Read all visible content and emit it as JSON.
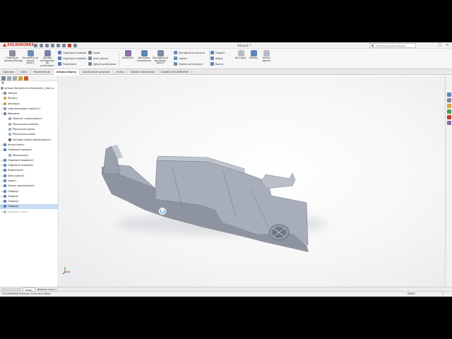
{
  "app": {
    "brand": "SOLIDWORKS",
    "document_title": "Arkusz1 *",
    "search_placeholder": "Polecenia wyszukiwania",
    "window_controls": [
      "–",
      "□",
      "×"
    ]
  },
  "ribbon": {
    "large_buttons": [
      {
        "label": "Odginięcie bazowe/Występ",
        "icon": "base-flange-icon",
        "color": "#8a8f98"
      },
      {
        "label": "Konwertuj na arkusz blachy",
        "icon": "convert-sheet-metal-icon",
        "color": "#6f8fb5"
      },
      {
        "label": "Występ wyciągnięty po przekrojach",
        "icon": "lofted-bend-icon",
        "color": "#7b7fa8"
      }
    ],
    "small_buttons_col1": [
      {
        "label": "Odginięcie krawędzi",
        "icon": "edge-flange-icon",
        "color": "#5b7fb5"
      },
      {
        "label": "Odginięcie dookolne",
        "icon": "miter-flange-icon",
        "color": "#5b7fb5"
      },
      {
        "label": "Podwinięcie",
        "icon": "hem-icon",
        "color": "#5b7fb5"
      }
    ],
    "small_buttons_col2": [
      {
        "label": "Uskok",
        "icon": "jog-icon",
        "color": "#7a8a9a"
      },
      {
        "label": "Szkic zgięcia",
        "icon": "sketched-bend-icon",
        "color": "#7a8a9a"
      },
      {
        "label": "Zgięcie przejściowe",
        "icon": "cross-break-icon",
        "color": "#7a8a9a"
      }
    ],
    "large_buttons_2": [
      {
        "label": "Narożniki",
        "icon": "corners-icon",
        "color": "#8a6fa8"
      },
      {
        "label": "Narzędzie formowania",
        "icon": "forming-tool-icon",
        "color": "#5a86b8"
      },
      {
        "label": "Wyciągnięcie wyciętego blachy",
        "icon": "extruded-cut-icon",
        "color": "#7d8aa0"
      }
    ],
    "small_buttons_col3": [
      {
        "label": "Wyciągnięcie wycięcia",
        "icon": "cut-extrude-icon",
        "color": "#6b8bb8"
      },
      {
        "label": "Otwórz",
        "icon": "simple-hole-icon",
        "color": "#6b8bb8"
      },
      {
        "label": "Otwórz wentylacyjny",
        "icon": "vent-icon",
        "color": "#6b8bb8"
      }
    ],
    "small_buttons_col4": [
      {
        "label": "Odegnij",
        "icon": "unfold-icon",
        "color": "#5a86b8"
      },
      {
        "label": "Zegnij",
        "icon": "fold-icon",
        "color": "#5a86b8"
      },
      {
        "label": "Rozkuj",
        "icon": "flatten-icon",
        "color": "#5a86b8"
      }
    ],
    "large_buttons_3": [
      {
        "label": "Bez zgięć",
        "icon": "no-bends-icon",
        "color": "#b7bcc4"
      },
      {
        "label": "Rozszyj",
        "icon": "rip-icon",
        "color": "#5a86b8"
      },
      {
        "label": "Wstaw zgięcia",
        "icon": "insert-bends-icon",
        "color": "#b7bcc4"
      }
    ]
  },
  "command_tabs": [
    {
      "label": "Operacje",
      "active": false
    },
    {
      "label": "Szkic",
      "active": false
    },
    {
      "label": "Powierzchnie",
      "active": false
    },
    {
      "label": "Arkusz blachy",
      "active": true
    },
    {
      "label": "Konstrukcje spawane",
      "active": false
    },
    {
      "label": "Ocena",
      "active": false
    },
    {
      "label": "Dodatki Wymiarów",
      "active": false
    },
    {
      "label": "Dodatki SOLIDWORKS",
      "active": false
    }
  ],
  "feature_tree": {
    "root": "Arkusz (Domyślne<<Domyślne>_Stan w",
    "items": [
      {
        "label": "Historia",
        "icon": "history-icon",
        "color": "#7a8a9a",
        "exp": "▸",
        "sel": false,
        "dim": false,
        "indent": 1
      },
      {
        "label": "Sensory",
        "icon": "sensors-icon",
        "color": "#d1a640",
        "exp": "",
        "sel": false,
        "dim": false,
        "indent": 1
      },
      {
        "label": "Adnotacje",
        "icon": "annotations-icon",
        "color": "#c9a53a",
        "exp": "▸",
        "sel": false,
        "dim": false,
        "indent": 1
      },
      {
        "label": "Lista elementów ciętych(1)",
        "icon": "cut-list-icon",
        "color": "#8a9bb0",
        "exp": "▸",
        "sel": false,
        "dim": false,
        "indent": 1
      },
      {
        "label": "Równania",
        "icon": "equations-icon",
        "color": "#8a6fa8",
        "exp": "▸",
        "sel": false,
        "dim": false,
        "indent": 1
      },
      {
        "label": "Materiał <nieokreślony>",
        "icon": "material-icon",
        "color": "#9aa6b2",
        "exp": "",
        "sel": false,
        "dim": false,
        "indent": 2
      },
      {
        "label": "Płaszczyzna przednia",
        "icon": "plane-icon",
        "color": "#9ab0c8",
        "exp": "",
        "sel": false,
        "dim": false,
        "indent": 2
      },
      {
        "label": "Płaszczyzna górna",
        "icon": "plane-icon",
        "color": "#9ab0c8",
        "exp": "",
        "sel": false,
        "dim": false,
        "indent": 2
      },
      {
        "label": "Płaszczyzna prawa",
        "icon": "plane-icon",
        "color": "#9ab0c8",
        "exp": "",
        "sel": false,
        "dim": false,
        "indent": 2
      },
      {
        "label": "Początek układu współrzędnych",
        "icon": "origin-icon",
        "color": "#6b6b6b",
        "exp": "",
        "sel": false,
        "dim": false,
        "indent": 2
      },
      {
        "label": "Arkusz blachy",
        "icon": "sheet-metal-icon",
        "color": "#5a86b8",
        "exp": "▸",
        "sel": false,
        "dim": false,
        "indent": 1
      },
      {
        "label": "Odginięcie bazowe1",
        "icon": "base-flange-icon",
        "color": "#5a86b8",
        "exp": "▸",
        "sel": false,
        "dim": false,
        "indent": 1
      },
      {
        "label": "Płaszczyzna1",
        "icon": "plane-icon",
        "color": "#9ab0c8",
        "exp": "",
        "sel": false,
        "dim": false,
        "indent": 2
      },
      {
        "label": "Odginięcie dookolne1",
        "icon": "miter-flange-icon",
        "color": "#5a86b8",
        "exp": "▸",
        "sel": false,
        "dim": false,
        "indent": 1
      },
      {
        "label": "Odginięcie krawędzi1",
        "icon": "edge-flange-icon",
        "color": "#5a86b8",
        "exp": "▸",
        "sel": false,
        "dim": false,
        "indent": 1
      },
      {
        "label": "Podwinięcie1",
        "icon": "hem-icon",
        "color": "#5a86b8",
        "exp": "▸",
        "sel": false,
        "dim": false,
        "indent": 1
      },
      {
        "label": "Szkic zgięcia1",
        "icon": "sketched-bend-icon",
        "color": "#5a86b8",
        "exp": "▸",
        "sel": false,
        "dim": false,
        "indent": 1
      },
      {
        "label": "Uskok1",
        "icon": "jog-icon",
        "color": "#5a86b8",
        "exp": "▸",
        "sel": false,
        "dim": false,
        "indent": 1
      },
      {
        "label": "Otwory wentylacyjne1",
        "icon": "vent-icon",
        "color": "#5a86b8",
        "exp": "▸",
        "sel": false,
        "dim": false,
        "indent": 1
      },
      {
        "label": "Odegnij2",
        "icon": "unfold-icon",
        "color": "#5a86b8",
        "exp": "▸",
        "sel": false,
        "dim": false,
        "indent": 1
      },
      {
        "label": "Odegnij2",
        "icon": "unfold-icon",
        "color": "#5a86b8",
        "exp": "▸",
        "sel": false,
        "dim": false,
        "indent": 1
      },
      {
        "label": "Odegnij3",
        "icon": "unfold-icon",
        "color": "#5a86b8",
        "exp": "▸",
        "sel": false,
        "dim": false,
        "indent": 1
      },
      {
        "label": "Odegnij4",
        "icon": "fold-icon",
        "color": "#5a86b8",
        "exp": "▸",
        "sel": true,
        "dim": false,
        "indent": 1
      },
      {
        "label": "Rozłożony model",
        "icon": "flat-pattern-icon",
        "color": "#b5bcc6",
        "exp": "▸",
        "sel": false,
        "dim": true,
        "indent": 1
      }
    ]
  },
  "bottom_tabs": [
    {
      "label": "Model",
      "active": true
    },
    {
      "label": "Badanie ruchu 1",
      "active": false
    }
  ],
  "status": {
    "text": "SOLIDWORKS Premium 2016 x64 Edition",
    "units": "MMGS",
    "help": "?"
  },
  "colors": {
    "brand_red": "#d4271b",
    "part_body": "#a4aab6",
    "selection": "#c7dcf2",
    "spinner": "#2b79c9"
  }
}
